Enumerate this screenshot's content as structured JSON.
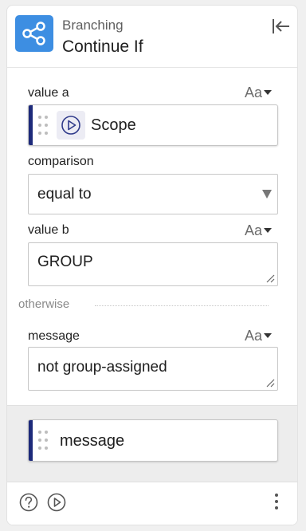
{
  "header": {
    "category": "Branching",
    "title": "Continue If",
    "icon": "share-icon",
    "accent": "#3d8ee2"
  },
  "fields": {
    "value_a": {
      "label": "value a",
      "type_toggle": "Aa",
      "block_label": "Scope",
      "block_icon": "play-circle-icon"
    },
    "comparison": {
      "label": "comparison",
      "value": "equal to"
    },
    "value_b": {
      "label": "value b",
      "type_toggle": "Aa",
      "value": "GROUP"
    },
    "otherwise_label": "otherwise",
    "message": {
      "label": "message",
      "type_toggle": "Aa",
      "value": "not group-assigned"
    }
  },
  "drop_area": {
    "block_label": "message"
  },
  "footer": {
    "help_icon": "help-circle-icon",
    "run_icon": "play-circle-icon",
    "more_icon": "kebab-icon"
  },
  "colors": {
    "block_strip": "#1d2a7a"
  }
}
